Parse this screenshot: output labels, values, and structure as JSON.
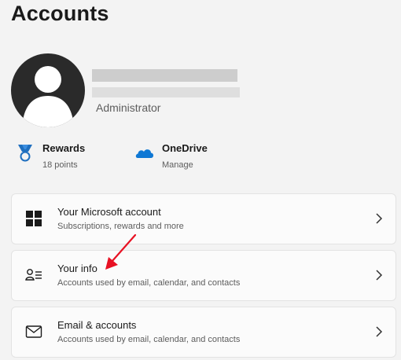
{
  "page": {
    "title": "Accounts"
  },
  "profile": {
    "role": "Administrator"
  },
  "services": [
    {
      "name": "Rewards",
      "sub": "18 points",
      "icon": "rewards-medal-icon"
    },
    {
      "name": "OneDrive",
      "sub": "Manage",
      "icon": "onedrive-cloud-icon"
    }
  ],
  "cards": [
    {
      "title": "Your Microsoft account",
      "subtitle": "Subscriptions, rewards and more",
      "icon": "windows-logo-icon"
    },
    {
      "title": "Your info",
      "subtitle": "Accounts used by email, calendar, and contacts",
      "icon": "person-info-icon"
    },
    {
      "title": "Email & accounts",
      "subtitle": "Accounts used by email, calendar, and contacts",
      "icon": "mail-icon"
    }
  ],
  "colors": {
    "accent": "#0067c0",
    "annotation": "#e81123",
    "onedrive": "#0f78d4"
  }
}
